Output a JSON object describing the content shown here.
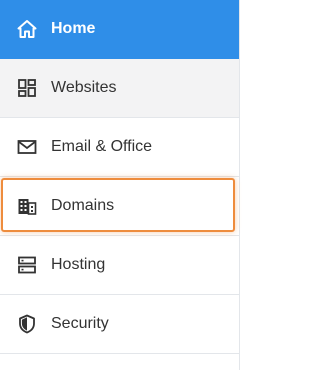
{
  "colors": {
    "active_bg": "#2f8ee8",
    "active_text": "#ffffff",
    "text": "#333333",
    "hover_bg": "#f3f3f4",
    "highlight_border": "#ee8c3d",
    "divider": "#e3e6ea"
  },
  "sidebar": {
    "items": [
      {
        "label": "Home",
        "icon": "home-icon",
        "state": "active"
      },
      {
        "label": "Websites",
        "icon": "dashboard-grid-icon",
        "state": "hover"
      },
      {
        "label": "Email & Office",
        "icon": "envelope-icon",
        "state": "normal"
      },
      {
        "label": "Domains",
        "icon": "building-icon",
        "state": "highlighted"
      },
      {
        "label": "Hosting",
        "icon": "server-icon",
        "state": "normal"
      },
      {
        "label": "Security",
        "icon": "shield-icon",
        "state": "normal"
      }
    ]
  }
}
